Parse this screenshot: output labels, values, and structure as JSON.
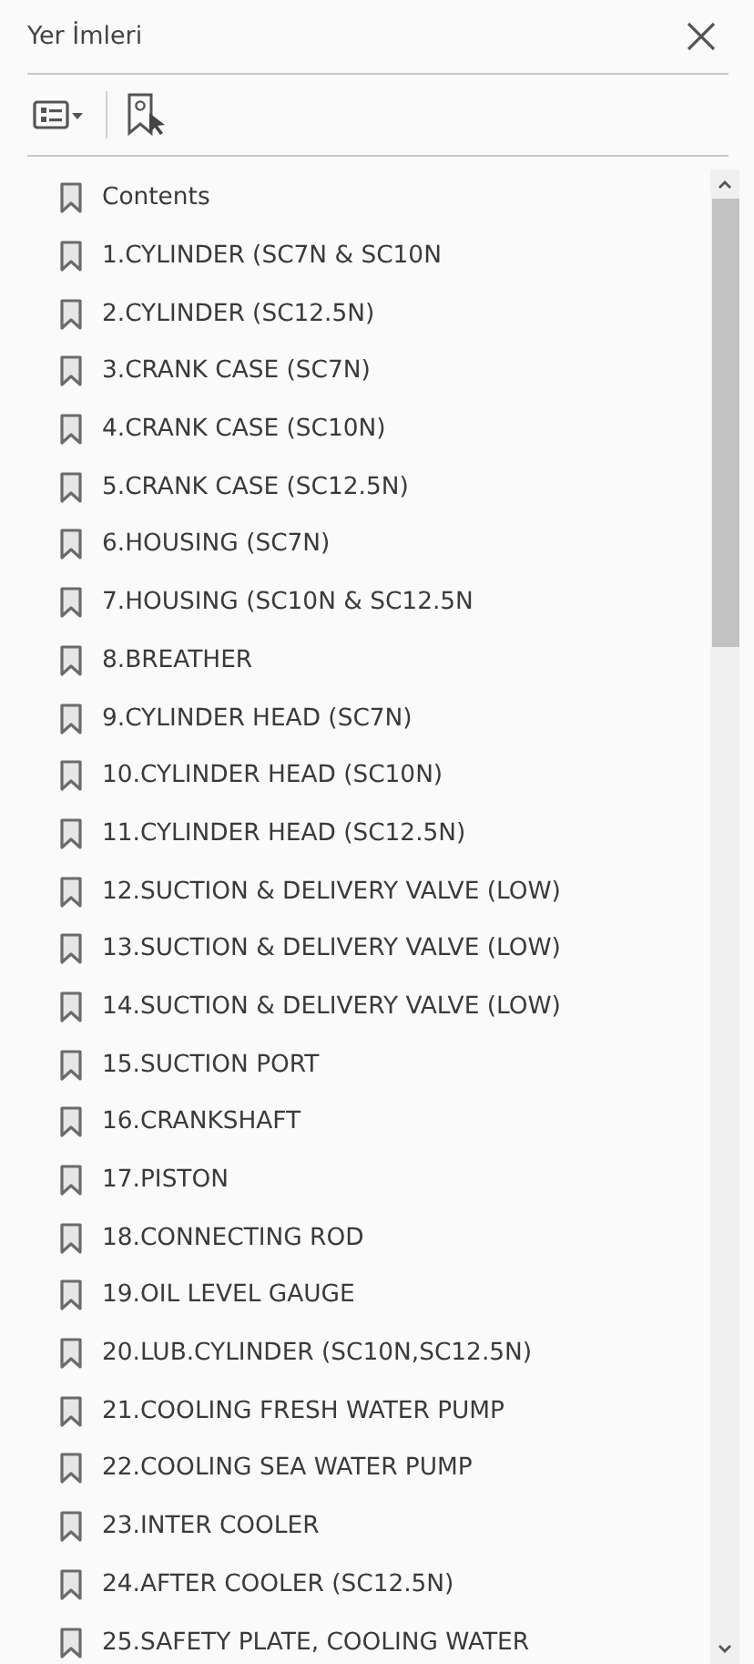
{
  "panel": {
    "title": "Yer İmleri"
  },
  "bookmarks": [
    {
      "label": "Contents"
    },
    {
      "label": "1.CYLINDER (SC7N & SC10N"
    },
    {
      "label": "2.CYLINDER (SC12.5N)"
    },
    {
      "label": "3.CRANK CASE (SC7N)"
    },
    {
      "label": "4.CRANK CASE (SC10N)"
    },
    {
      "label": "5.CRANK CASE (SC12.5N)"
    },
    {
      "label": "6.HOUSING (SC7N)"
    },
    {
      "label": "7.HOUSING (SC10N & SC12.5N"
    },
    {
      "label": "8.BREATHER"
    },
    {
      "label": "9.CYLINDER HEAD (SC7N)"
    },
    {
      "label": "10.CYLINDER HEAD (SC10N)"
    },
    {
      "label": "11.CYLINDER HEAD (SC12.5N)"
    },
    {
      "label": "12.SUCTION & DELIVERY VALVE (LOW)"
    },
    {
      "label": "13.SUCTION & DELIVERY VALVE (LOW)"
    },
    {
      "label": "14.SUCTION & DELIVERY VALVE (LOW)"
    },
    {
      "label": "15.SUCTION PORT"
    },
    {
      "label": "16.CRANKSHAFT"
    },
    {
      "label": "17.PISTON"
    },
    {
      "label": "18.CONNECTING ROD"
    },
    {
      "label": "19.OIL LEVEL GAUGE"
    },
    {
      "label": "20.LUB.CYLINDER (SC10N,SC12.5N)"
    },
    {
      "label": "21.COOLING FRESH WATER PUMP"
    },
    {
      "label": "22.COOLING SEA WATER PUMP"
    },
    {
      "label": "23.INTER COOLER"
    },
    {
      "label": "24.AFTER COOLER  (SC12.5N)"
    },
    {
      "label": "25.SAFETY PLATE, COOLING WATER"
    }
  ]
}
